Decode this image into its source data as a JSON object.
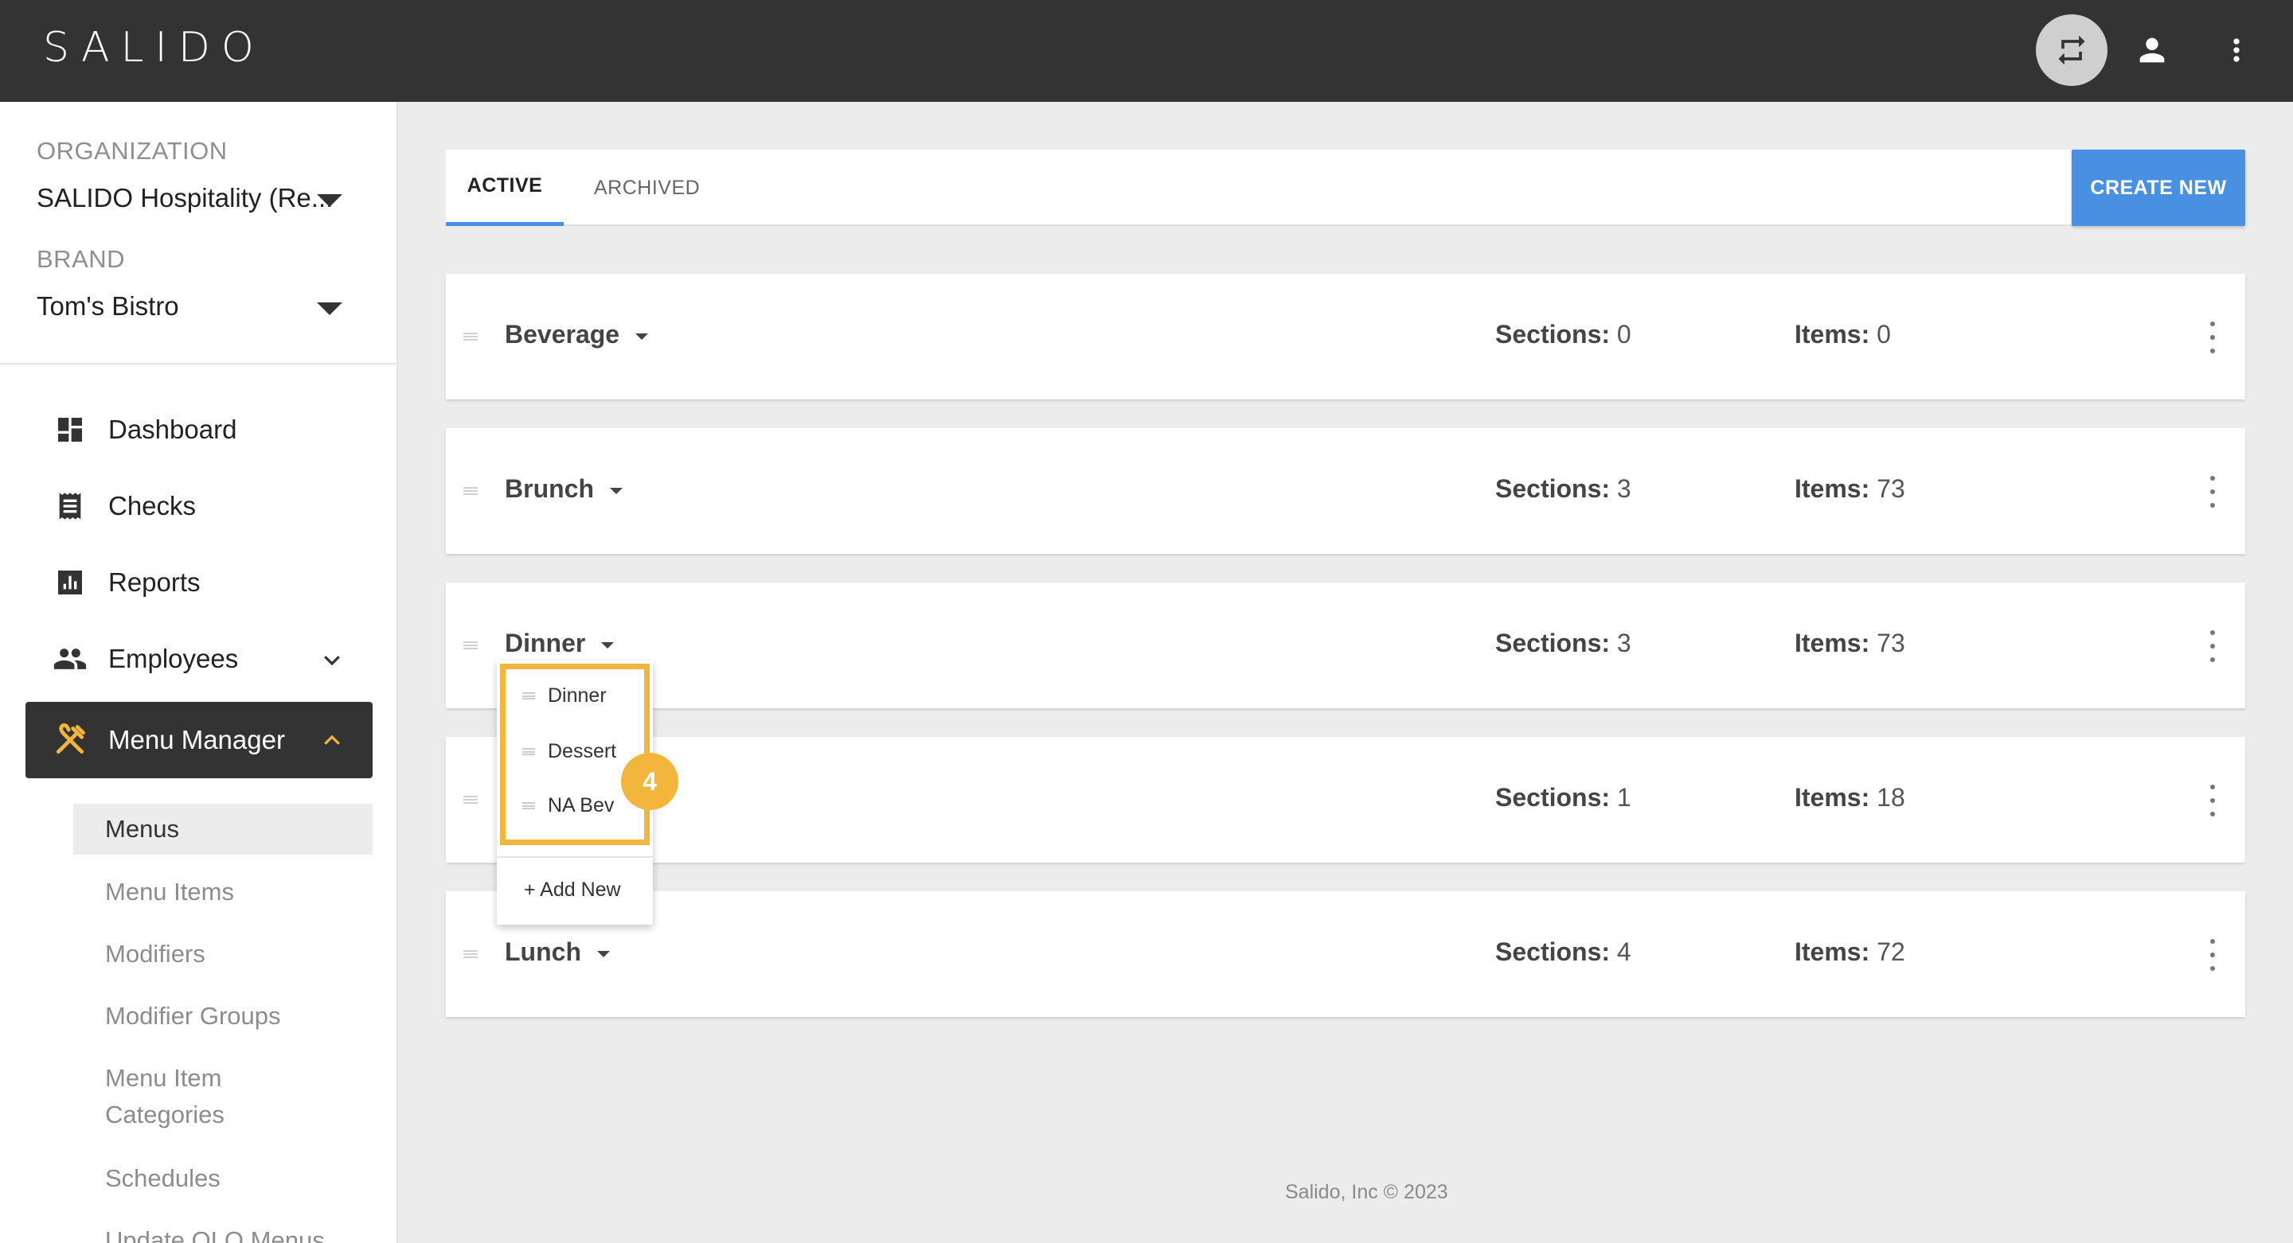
{
  "app": {
    "logo_text": "SALIDO"
  },
  "topbar": {
    "icons": [
      "switch-icon",
      "account-icon",
      "more-vert-icon"
    ]
  },
  "sidebar": {
    "organization_label": "ORGANIZATION",
    "organization_value": "SALIDO Hospitality (Re...",
    "brand_label": "BRAND",
    "brand_value": "Tom's Bistro",
    "nav": [
      {
        "label": "Dashboard",
        "icon": "dashboard-icon"
      },
      {
        "label": "Checks",
        "icon": "receipt-icon"
      },
      {
        "label": "Reports",
        "icon": "bar-chart-icon"
      },
      {
        "label": "Employees",
        "icon": "people-icon"
      },
      {
        "label": "Menu Manager",
        "icon": "utensils-icon"
      }
    ],
    "sub_nav": [
      {
        "label": "Menus"
      },
      {
        "label": "Menu Items"
      },
      {
        "label": "Modifiers"
      },
      {
        "label": "Modifier Groups"
      },
      {
        "label": "Menu Item Categories"
      },
      {
        "label": "Schedules"
      },
      {
        "label": "Update OLO Menus"
      }
    ],
    "accent_color": "#f2b63c"
  },
  "main": {
    "tabs": [
      {
        "label": "ACTIVE"
      },
      {
        "label": "ARCHIVED"
      }
    ],
    "create_button": "CREATE NEW",
    "sections_label": "Sections:",
    "items_label": "Items:",
    "menus": [
      {
        "name": "Beverage",
        "sections": "0",
        "items": "0"
      },
      {
        "name": "Brunch",
        "sections": "3",
        "items": "73"
      },
      {
        "name": "Dinner",
        "sections": "3",
        "items": "73"
      },
      {
        "name": "",
        "sections": "1",
        "items": "18"
      },
      {
        "name": "Lunch",
        "sections": "4",
        "items": "72"
      }
    ]
  },
  "dropdown": {
    "items": [
      {
        "label": "Dinner"
      },
      {
        "label": "Dessert"
      },
      {
        "label": "NA Bev"
      }
    ],
    "add_new": "+ Add New",
    "step_badge": "4"
  },
  "footer": {
    "text": "Salido, Inc © 2023"
  },
  "colors": {
    "topbar": "#333333",
    "primary": "#4a90e2",
    "highlight": "#f2b63c"
  }
}
